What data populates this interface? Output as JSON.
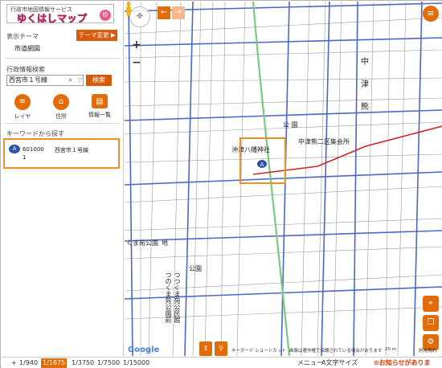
{
  "app": {
    "logo_sub": "行政市地図情報サービス",
    "logo_main": "ゆくはしマップ",
    "logo_mark": "ゆく"
  },
  "sidebar": {
    "theme_label": "表示テーマ",
    "theme_button": "テーマ変更 ▶",
    "theme_value": "市道網図",
    "search_label": "行政情報検索",
    "search_value": "西宮市１号線",
    "clear_icon": "×",
    "dropdown_icon": "▽",
    "search_button": "検索",
    "tools": [
      {
        "icon": "layer-icon",
        "glyph": "≡",
        "label": "レイヤ"
      },
      {
        "icon": "home-icon",
        "glyph": "⌂",
        "label": "住所"
      },
      {
        "icon": "list-icon",
        "glyph": "▤",
        "label": "情報一覧"
      }
    ],
    "keyword_label": "キーワードから探す",
    "result": {
      "pin": "A",
      "code": "601000",
      "name": "西宮市１号線",
      "num": "1"
    },
    "collapse": "«"
  },
  "map": {
    "zoom_in": "+",
    "zoom_out": "−",
    "back": "←",
    "forward": "→",
    "menu": "≡",
    "labels": {
      "naka": "中",
      "tsu": "津",
      "kuma": "熊",
      "koen1": "公 園",
      "shrine": "沖津八幡神社",
      "hall": "中津熊二区集会所",
      "kumaen": "くま苑公園",
      "koen2": "公園",
      "kumaen2": "つつくま苑公民館",
      "kumaen3": "つのくま苑公園前",
      "kumaen_suffix": "地"
    },
    "marker": "A",
    "google": "Google",
    "attrib_shortcut": "キーボード ショートカット",
    "attrib_copy": "画像は著作権で保護されている場合があります",
    "attrib_scale": "20 m",
    "attrib_terms": "利用規約",
    "fabs": [
      "⌖",
      "❐",
      "⚙"
    ],
    "bottom_buttons": [
      "⇕",
      "⚲"
    ]
  },
  "footer": {
    "scales": [
      "1/940",
      "1/1875",
      "1/3750",
      "1/7500",
      "1/15000"
    ],
    "selected_scale": "1/1875",
    "plus": "+",
    "menu_label": "メニュー",
    "font_label": "A文字サイズ",
    "notice": "⊙お知らせがあります。"
  },
  "colors": {
    "accent": "#e36c0a",
    "highlight": "#f0901e",
    "road_blue": "#4c67c9",
    "road_green": "#7bc97b",
    "road_red": "#d42020"
  }
}
